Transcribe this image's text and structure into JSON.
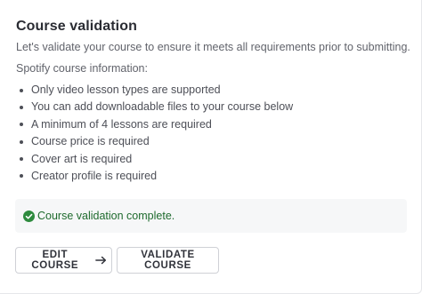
{
  "title": "Course validation",
  "intro": "Let's validate your course to ensure it meets all requirements prior to submitting.",
  "subhead": "Spotify course information:",
  "requirements": [
    "Only video lesson types are supported",
    "You can add downloadable files to your course below",
    "A minimum of 4 lessons are required",
    "Course price is required",
    "Cover art is required",
    "Creator profile is required"
  ],
  "status": {
    "text": "Course validation complete.",
    "icon": "check-circle-icon",
    "color": "#2e8b3e"
  },
  "buttons": {
    "edit_label": "EDIT COURSE",
    "edit_icon": "arrow-right-icon",
    "validate_label": "VALIDATE COURSE"
  }
}
